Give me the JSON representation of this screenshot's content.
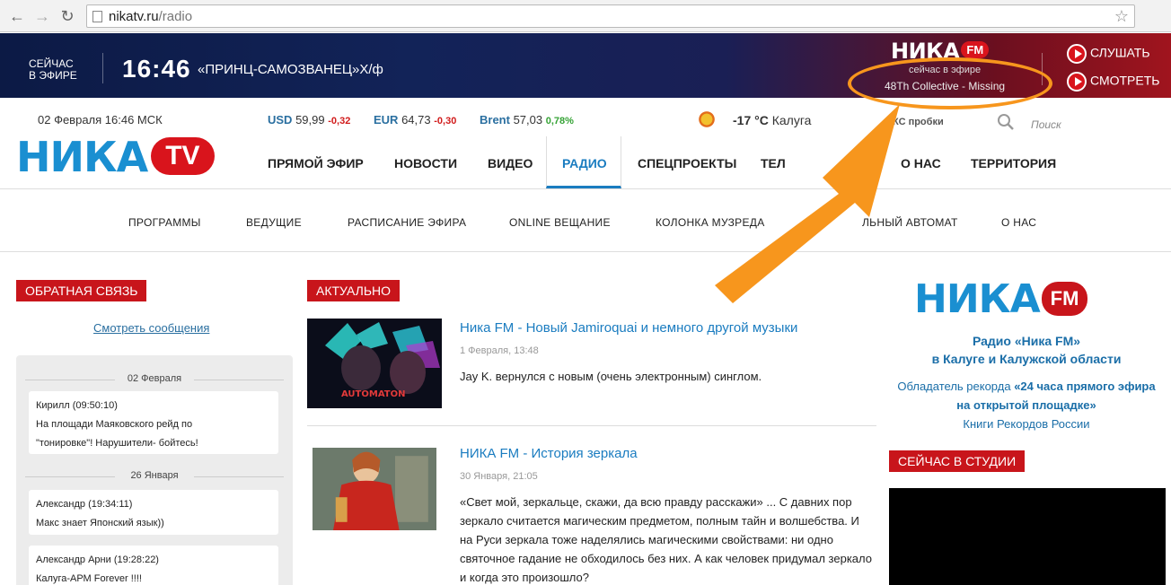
{
  "browser": {
    "url_host": "nikatv.ru",
    "url_path": "/radio"
  },
  "livebar": {
    "now_label_line1": "СЕЙЧАС",
    "now_label_line2": "В ЭФИРЕ",
    "time": "16:46",
    "show": "«ПРИНЦ-САМОЗВАНЕЦ»Х/ф",
    "fm_logo_word": "НИКА",
    "fm_logo_badge": "FM",
    "on_air_label": "сейчас в эфире",
    "track": "48Th Collective - Missing",
    "listen_label": "СЛУШАТЬ",
    "watch_label": "СМОТРЕТЬ"
  },
  "info": {
    "date": "02 Февраля 16:46 МСК",
    "usd_label": "USD",
    "usd_value": "59,99",
    "usd_change": "-0,32",
    "eur_label": "EUR",
    "eur_value": "64,73",
    "eur_change": "-0,30",
    "brent_label": "Brent",
    "brent_value": "57,03",
    "brent_change": "0,78%",
    "weather_temp": "-17 °С",
    "weather_city": "Калуга",
    "traffic": "КС пробки",
    "search_placeholder": "Поиск"
  },
  "logo": {
    "word": "НИКА",
    "badge": "TV"
  },
  "main_nav": [
    "ПРЯМОЙ ЭФИР",
    "НОВОСТИ",
    "ВИДЕО",
    "РАДИО",
    "СПЕЦПРОЕКТЫ",
    "ТЕЛ",
    "О НАС",
    "ТЕРРИТОРИЯ"
  ],
  "sub_nav": [
    "ПРОГРАММЫ",
    "ВЕДУЩИЕ",
    "РАСПИСАНИЕ ЭФИРА",
    "ONLINE ВЕЩАНИЕ",
    "КОЛОНКА МУЗРЕДА",
    "М",
    "ЛЬНЫЙ АВТОМАТ",
    "О НАС"
  ],
  "feedback": {
    "tag": "ОБРАТНАЯ СВЯЗЬ",
    "see_messages": "Смотреть сообщения",
    "days": [
      "02 Февраля",
      "26 Января"
    ],
    "messages": [
      {
        "author": "Кирилл (09:50:10)",
        "text1": "На площади Маяковского рейд по",
        "text2": "\"тонировке\"! Нарушители- бойтесь!"
      },
      {
        "author": "Александр (19:34:11)",
        "text1": "Макс знает Японский язык))"
      },
      {
        "author": "Александр Арни (19:28:22)",
        "text1": "Калуга-АРМ Forever !!!!"
      }
    ]
  },
  "actual": {
    "tag": "АКТУАЛЬНО",
    "news": [
      {
        "title": "Ника FM - Новый Jamiroquai и немного другой музыки",
        "date": "1 Февраля, 13:48",
        "text": "Jay K. вернулся с новым (очень электронным) синглом.",
        "image_caption": "AUTOMATON"
      },
      {
        "title": "НИКА FM - История зеркала",
        "date": "30 Января, 21:05",
        "text": "«Свет мой, зеркальце, скажи, да всю правду расскажи» ... С давних пор зеркало считается магическим предметом, полным тайн и волшебства. И на Руси зеркала тоже наделялись магическими свойствами: ни одно святочное гадание не обходилось без них. А как человек придумал зеркало и когда это произошло?"
      }
    ]
  },
  "radio": {
    "logo_word": "НИКА",
    "logo_badge": "FM",
    "title1": "Радио «Ника FM»",
    "title2": "в Калуге и Калужской области",
    "record_prefix": "Обладатель рекорда",
    "record_bold1": "«24 часа прямого эфира",
    "record_bold2": "на открытой площадке»",
    "record_book": "Книги Рекордов России",
    "studio_tag": "СЕЙЧАС В СТУДИИ"
  },
  "colors": {
    "brand_blue": "#1a8fd1",
    "brand_red": "#c8151b",
    "highlight_orange": "#f7961d"
  }
}
